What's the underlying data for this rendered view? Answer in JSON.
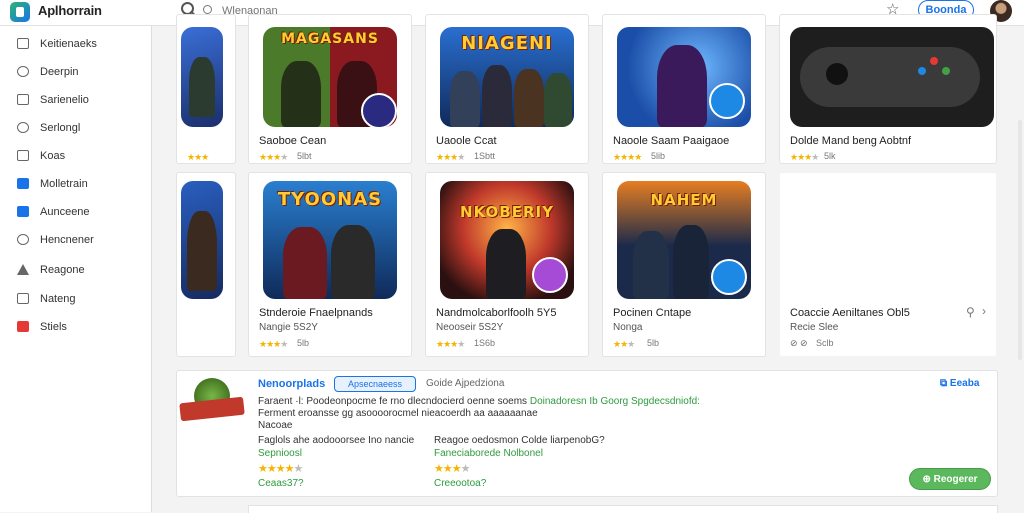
{
  "header": {
    "app_title": "Aplhorrain",
    "search_placeholder": "Wlenaonan",
    "action_label": "Boonda"
  },
  "sidebar": {
    "items": [
      {
        "label": "Keitienaeks",
        "icon": "apps-icon"
      },
      {
        "label": "Deerpin",
        "icon": "user-icon"
      },
      {
        "label": "Sarienelio",
        "icon": "image-icon"
      },
      {
        "label": "Serlongl",
        "icon": "chat-icon"
      },
      {
        "label": "Koas",
        "icon": "chart-icon"
      },
      {
        "label": "Molletrain",
        "icon": "window-icon"
      },
      {
        "label": "Aunceene",
        "icon": "calendar-icon"
      },
      {
        "label": "Hencnener",
        "icon": "settings-icon"
      },
      {
        "label": "Reagone",
        "icon": "pen-icon"
      },
      {
        "label": "Nateng",
        "icon": "folder-icon"
      },
      {
        "label": "Stiels",
        "icon": "store-icon"
      }
    ]
  },
  "row1": [
    {
      "title": "",
      "sub": "",
      "rating": "",
      "stars": 3
    },
    {
      "title": "Saoboe Cean",
      "sub": "",
      "rating": "5lbt",
      "stars": 3,
      "art": "MAGASANS"
    },
    {
      "title": "Uaoole Ccat",
      "sub": "",
      "rating": "1Sbtt",
      "stars": 3,
      "art": "NIAGENI"
    },
    {
      "title": "Naoole Saam Paaigaoe",
      "sub": "",
      "rating": "5lib",
      "stars": 4,
      "art": ""
    },
    {
      "title": "Dolde Mand beng Aobtnf",
      "sub": "",
      "rating": "5lk",
      "stars": 3,
      "art": ""
    }
  ],
  "row2": [
    {
      "title": "",
      "sub": "",
      "rating": "",
      "stars": 3
    },
    {
      "title": "Stnderoie Fnaelpnands",
      "sub": "Nangie 5S2Y",
      "rating": "5lb",
      "stars": 3,
      "art": "TYOONAS"
    },
    {
      "title": "Nandmolcaborlfoolh 5Y5",
      "sub": "Neooseir 5S2Y",
      "rating": "1S6b",
      "stars": 3,
      "art": "NKOBERIY"
    },
    {
      "title": "Pocinen Cntape",
      "sub": "Nonga",
      "rating": "5lb",
      "stars": 2,
      "art": "NAHEM"
    },
    {
      "title": "Coaccie Aeniltanes Obl5",
      "sub": "Recie Slee",
      "rating": "Sclb",
      "stars": 0,
      "art": ""
    }
  ],
  "featured": {
    "title": "Nenoorplads",
    "pill": "Apsecnaeess",
    "category": "Goide Ajpedziona",
    "link": "Eeaba",
    "line1": "Faraent ·l: Poodeonpocme fe rno dlecndocierd oenne soems",
    "line1_green": "Doinadoresn Ib  Goorg  Spgdecsdniofd:",
    "line2": "Ferment eroansse gg asoooorocmel nieacoerdh aa aaaaaanae",
    "line3": "Nacoae",
    "col1_label": "Faglols ahe aodooorsee Ino nancie",
    "col1_value": "Sepnioosl",
    "col1_price": "Ceaas37?",
    "col2_label": "Reagoe oedosmon Colde liarpenobG?",
    "col2_value": "Faneciaborede Nolbonel",
    "col2_price": "Creeootoa?",
    "install_label": "Reogerer",
    "col1_stars": 4,
    "col2_stars": 3
  }
}
